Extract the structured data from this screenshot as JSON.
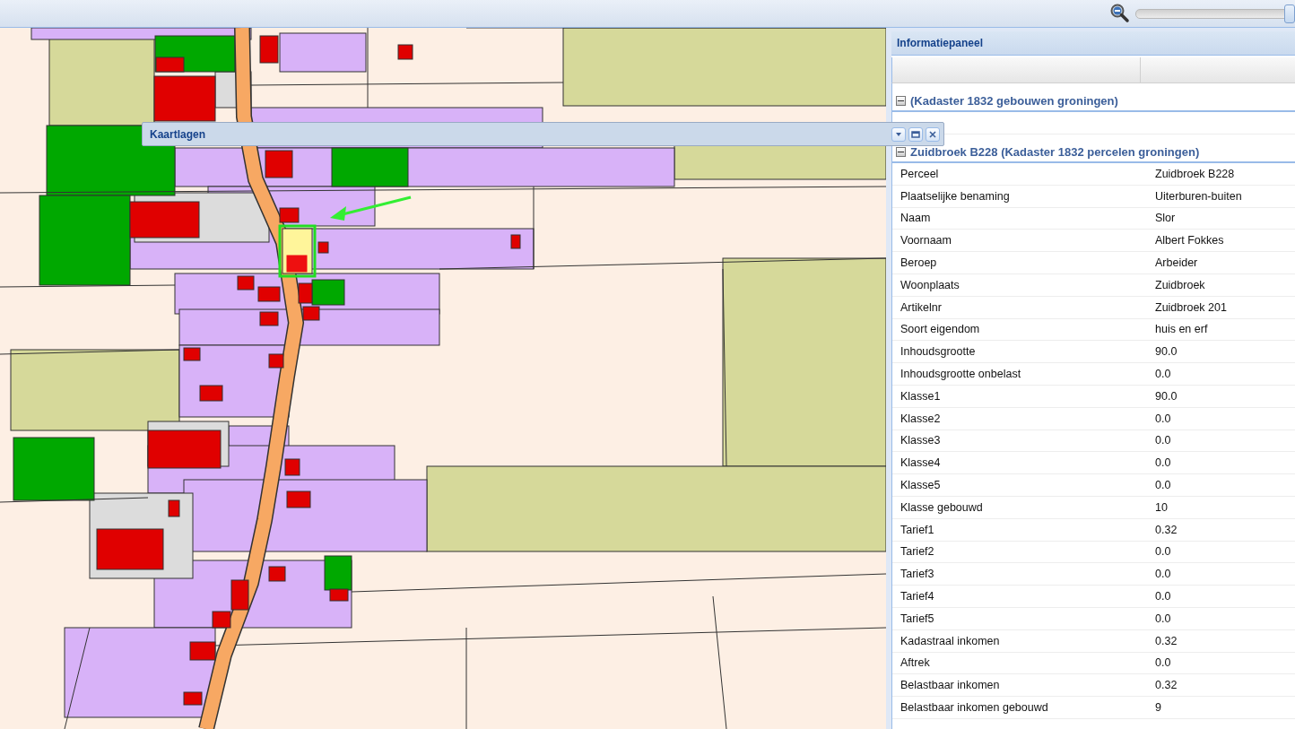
{
  "toolbar": {
    "zoom_slider": {
      "level": 1
    }
  },
  "floating_window": {
    "title": "Kaartlagen"
  },
  "info_panel": {
    "title": "Informatiepaneel",
    "groups": [
      {
        "title": "(Kadaster 1832 gebouwen groningen)",
        "expanded": true
      },
      {
        "title": "Zuidbroek B228 (Kadaster 1832 percelen groningen)",
        "expanded": true,
        "rows": [
          {
            "label": "Perceel",
            "value": "Zuidbroek B228"
          },
          {
            "label": "Plaatselijke benaming",
            "value": "Uiterburen-buiten"
          },
          {
            "label": "Naam",
            "value": "Slor"
          },
          {
            "label": "Voornaam",
            "value": "Albert Fokkes"
          },
          {
            "label": "Beroep",
            "value": "Arbeider"
          },
          {
            "label": "Woonplaats",
            "value": "Zuidbroek"
          },
          {
            "label": "Artikelnr",
            "value": "Zuidbroek 201"
          },
          {
            "label": "Soort eigendom",
            "value": "huis en erf"
          },
          {
            "label": "Inhoudsgrootte",
            "value": "90.0"
          },
          {
            "label": "Inhoudsgrootte onbelast",
            "value": "0.0"
          },
          {
            "label": "Klasse1",
            "value": "90.0"
          },
          {
            "label": "Klasse2",
            "value": "0.0"
          },
          {
            "label": "Klasse3",
            "value": "0.0"
          },
          {
            "label": "Klasse4",
            "value": "0.0"
          },
          {
            "label": "Klasse5",
            "value": "0.0"
          },
          {
            "label": "Klasse gebouwd",
            "value": "10"
          },
          {
            "label": "Tarief1",
            "value": "0.32"
          },
          {
            "label": "Tarief2",
            "value": "0.0"
          },
          {
            "label": "Tarief3",
            "value": "0.0"
          },
          {
            "label": "Tarief4",
            "value": "0.0"
          },
          {
            "label": "Tarief5",
            "value": "0.0"
          },
          {
            "label": "Kadastraal inkomen",
            "value": "0.32"
          },
          {
            "label": "Aftrek",
            "value": "0.0"
          },
          {
            "label": "Belastbaar inkomen",
            "value": "0.32"
          },
          {
            "label": "Belastbaar inkomen gebouwd",
            "value": "9"
          }
        ]
      }
    ]
  }
}
